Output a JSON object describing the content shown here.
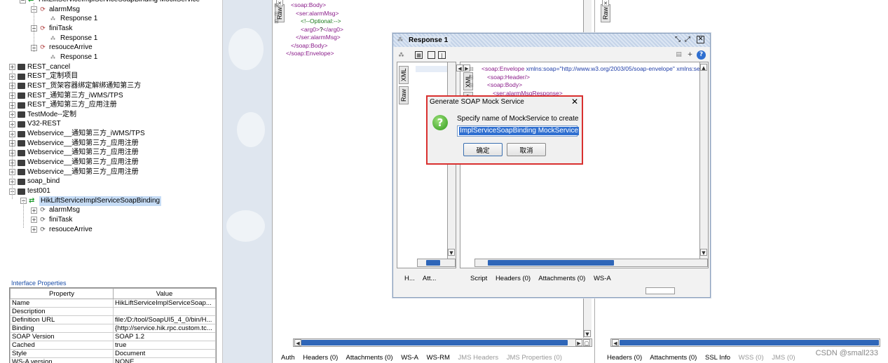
{
  "navigator": {
    "tree": [
      {
        "label": "HikLiftServiceImplServiceSoapBinding MockService",
        "kind": "mock"
      },
      {
        "label": "alarmMsg",
        "kind": "op"
      },
      {
        "label": "Response 1",
        "kind": "resp"
      },
      {
        "label": "finiTask",
        "kind": "op"
      },
      {
        "label": "Response 1",
        "kind": "resp"
      },
      {
        "label": "resouceArrive",
        "kind": "op"
      },
      {
        "label": "Response 1",
        "kind": "resp"
      },
      {
        "label": "REST_cancel",
        "kind": "folder"
      },
      {
        "label": "REST_定制项目",
        "kind": "folder"
      },
      {
        "label": "REST_货架容器绑定解绑通知第三方",
        "kind": "folder"
      },
      {
        "label": "REST_通知第三方_iWMS/TPS",
        "kind": "folder"
      },
      {
        "label": "REST_通知第三方_应用注册",
        "kind": "folder"
      },
      {
        "label": "TestMode--定制",
        "kind": "folder"
      },
      {
        "label": "V32-REST",
        "kind": "folder"
      },
      {
        "label": "Webservice__通知第三方_iWMS/TPS",
        "kind": "folder"
      },
      {
        "label": "Webservice__通知第三方_应用注册",
        "kind": "folder"
      },
      {
        "label": "Webservice__通知第三方_应用注册",
        "kind": "folder"
      },
      {
        "label": "Webservice__通知第三方_应用注册",
        "kind": "folder"
      },
      {
        "label": "Webservice__通知第三方_应用注册",
        "kind": "folder"
      },
      {
        "label": "soap_bind",
        "kind": "folder"
      },
      {
        "label": "test001",
        "kind": "folder-open"
      },
      {
        "label": "HikLiftServiceImplServiceSoapBinding",
        "kind": "binding"
      },
      {
        "label": "alarmMsg",
        "kind": "op2"
      },
      {
        "label": "finiTask",
        "kind": "op2"
      },
      {
        "label": "resouceArrive",
        "kind": "op2"
      }
    ],
    "props_title": "Interface Properties",
    "props_headers": [
      "Property",
      "Value"
    ],
    "props_rows": [
      [
        "Name",
        "HikLiftServiceImplServiceSoap..."
      ],
      [
        "Description",
        ""
      ],
      [
        "Definition URL",
        "file:/D:/tool/SoapUI5_4_0/bin/H..."
      ],
      [
        "Binding",
        "{http://service.hik.rpc.custom.tc..."
      ],
      [
        "SOAP Version",
        "SOAP 1.2"
      ],
      [
        "Cached",
        "true"
      ],
      [
        "Style",
        "Document"
      ],
      [
        "WS-A version",
        "NONE"
      ]
    ]
  },
  "request_editor": {
    "side_tab": "Raw",
    "xml_lines": [
      {
        "indent": 0,
        "parts": [
          [
            "tag",
            "<soap:Body>"
          ]
        ]
      },
      {
        "indent": 1,
        "parts": [
          [
            "tag",
            "<ser:alarmMsg>"
          ]
        ]
      },
      {
        "indent": 2,
        "parts": [
          [
            "com",
            "<!--Optional:-->"
          ]
        ]
      },
      {
        "indent": 2,
        "parts": [
          [
            "tag",
            "<arg0>"
          ],
          [
            "txt",
            "?"
          ],
          [
            "tag",
            "</arg0>"
          ]
        ]
      },
      {
        "indent": 1,
        "parts": [
          [
            "tag",
            "</ser:alarmMsg>"
          ]
        ]
      },
      {
        "indent": 0,
        "parts": [
          [
            "tag",
            "</soap:Body>"
          ]
        ]
      },
      {
        "indent": -1,
        "parts": [
          [
            "tag",
            "</soap:Envelope>"
          ]
        ]
      }
    ],
    "bottom_tabs": [
      "Auth",
      "Headers (0)",
      "Attachments (0)",
      "WS-A",
      "WS-RM"
    ],
    "bottom_tabs_disabled": [
      "JMS Headers",
      "JMS Properties (0)"
    ]
  },
  "right_panel": {
    "side_tab": "Raw",
    "bottom_tabs": [
      "Headers (0)",
      "Attachments (0)",
      "SSL Info"
    ],
    "bottom_tabs_disabled": [
      "WSS (0)",
      "JMS (0)"
    ]
  },
  "response_window": {
    "title": "Response 1",
    "left_tabs": [
      "XML",
      "Raw"
    ],
    "xml_lines": [
      {
        "indent": 0,
        "parts": [
          [
            "tag",
            "<soap:Envelope "
          ],
          [
            "attr",
            "xmlns:soap="
          ],
          [
            "val",
            "\"http://www.w3.org/2003/05/soap-envelope\""
          ],
          [
            "attr",
            " xmlns:se"
          ]
        ]
      },
      {
        "indent": 1,
        "parts": [
          [
            "tag",
            "<soap:Header/>"
          ]
        ]
      },
      {
        "indent": 1,
        "parts": [
          [
            "tag",
            "<soap:Body>"
          ]
        ]
      },
      {
        "indent": 2,
        "parts": [
          [
            "tag",
            "<ser:alarmMsgResponse>"
          ]
        ]
      }
    ],
    "left_bottom_tabs": [
      "H...",
      "Att..."
    ],
    "bottom_tabs": [
      "Script",
      "Headers (0)",
      "Attachments (0)",
      "WS-A"
    ]
  },
  "dialog": {
    "title": "Generate SOAP Mock Service",
    "message": "Specify name of MockService to create",
    "input_value": "ImplServiceSoapBinding MockService",
    "ok_label": "确定",
    "cancel_label": "取消"
  },
  "watermark": "CSDN @small233",
  "colors": {
    "xml_tag": "#8a1c8a",
    "xml_attr": "#1f3ea8",
    "xml_comment": "#1c7a1c",
    "highlight_border": "#d9302f",
    "selection": "#c6dcf5",
    "accent": "#2f66b8"
  }
}
